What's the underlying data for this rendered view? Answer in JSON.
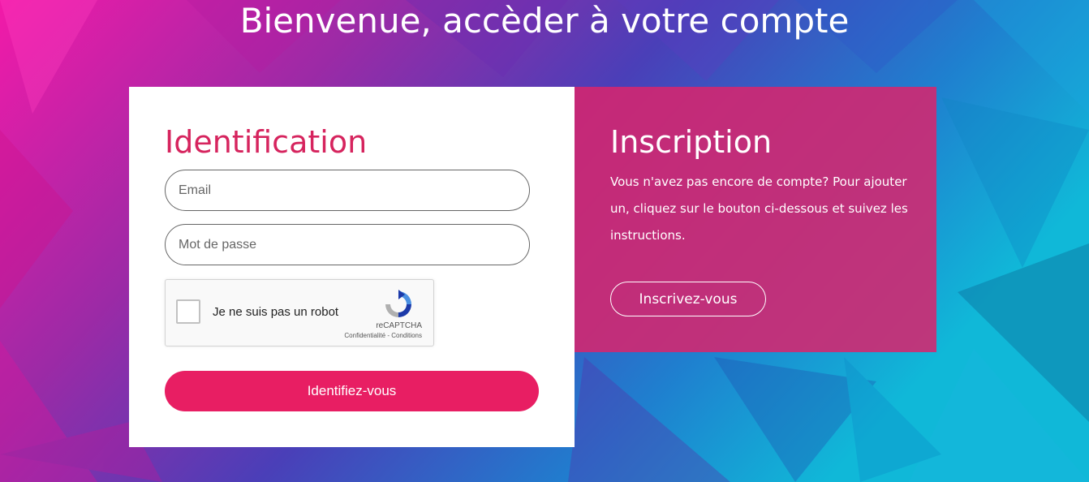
{
  "headline": "Bienvenue, accèder à votre compte",
  "login": {
    "title": "Identification",
    "email_placeholder": "Email",
    "password_placeholder": "Mot de passe",
    "captcha": {
      "label": "Je ne suis pas un robot",
      "brand": "reCAPTCHA",
      "links": "Confidentialité - Conditions"
    },
    "submit_label": "Identifiez-vous"
  },
  "signup": {
    "title": "Inscription",
    "text": "Vous n'avez pas encore de compte? Pour ajouter un, cliquez sur le bouton ci-dessous et suivez les instructions.",
    "button_label": "Inscrivez-vous"
  },
  "colors": {
    "accent": "#e81e63",
    "title_pink": "#d6245e",
    "panel_pink": "#d6266e"
  }
}
